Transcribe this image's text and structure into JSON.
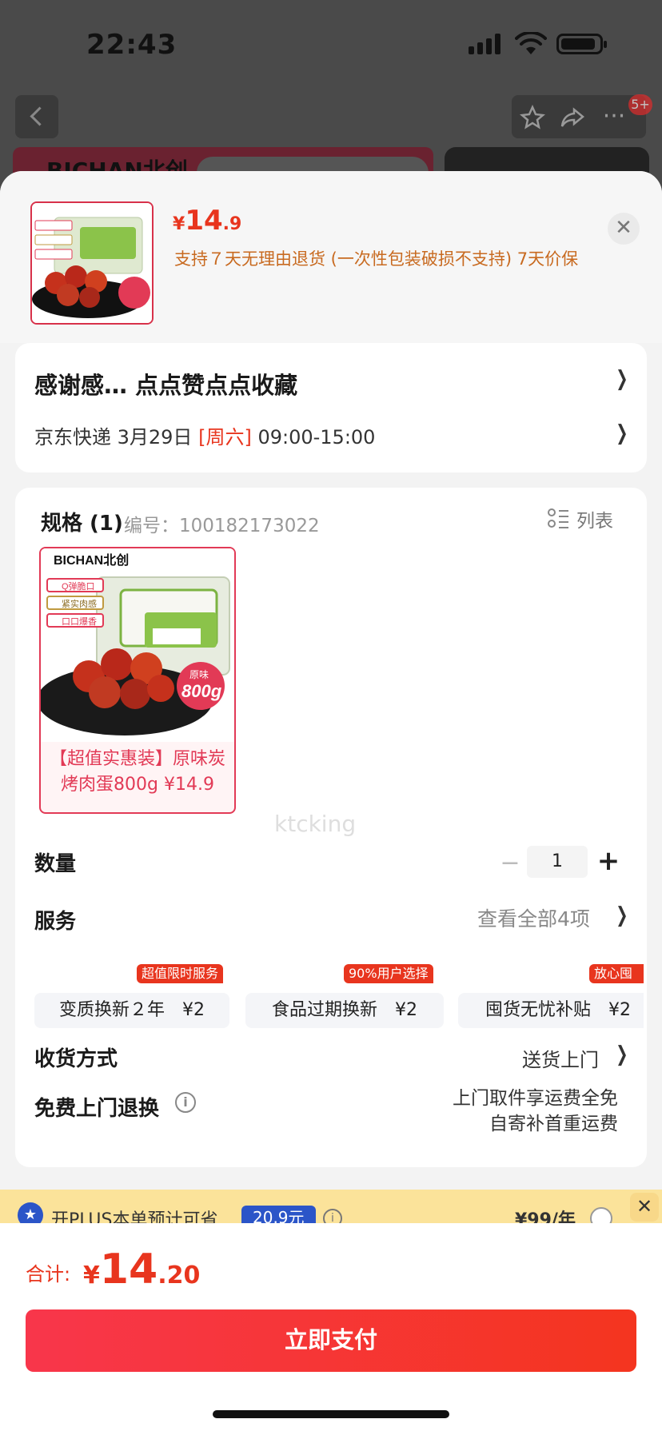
{
  "status": {
    "time": "22:43"
  },
  "background": {
    "badge": "5+",
    "brand_text": "BICHAN北创"
  },
  "header": {
    "price_currency": "¥",
    "price_int": "14",
    "price_dec": ".9",
    "note": "支持７天无理由退货 (一次性包装破损不支持)   7天价保"
  },
  "address": {
    "title": "感谢感… 点点赞点点收藏",
    "carrier": "京东快递 3月29日",
    "weekday": "[周六]",
    "time_window": "09:00-15:00"
  },
  "spec": {
    "title": "规格 (1)",
    "code": "编号：100182173022",
    "list_label": "列表",
    "item_name": "【超值实惠装】原味炭烤肉蛋800g ¥14.9",
    "img": {
      "brand": "BICHAN北创",
      "features": [
        "Q弹脆口",
        "紧实肉感",
        "口口爆香"
      ],
      "weight": "800g",
      "flavor": "原味"
    }
  },
  "watermark": "ktcking",
  "quantity": {
    "label": "数量",
    "value": "1",
    "minus": "−",
    "plus": "+"
  },
  "service": {
    "label": "服务",
    "view_all": "查看全部4项",
    "chips": [
      {
        "text": "变质换新２年　¥2",
        "tag": "超值限时服务"
      },
      {
        "text": "食品过期换新　¥2",
        "tag": "90%用户选择"
      },
      {
        "text": "囤货无忧补贴　¥2",
        "tag": "放心囤"
      }
    ]
  },
  "receive": {
    "label": "收货方式",
    "value": "送货上门"
  },
  "free_return": {
    "label": "免费上门退换",
    "line1": "上门取件享运费全免",
    "line2": "自寄补首重运费"
  },
  "plus": {
    "text": "开PLUS本单预计可省",
    "amount": "20.9元",
    "price": "¥99/年"
  },
  "footer": {
    "total_label": "合计:",
    "currency": "¥",
    "total_int": "14",
    "total_dec": ".20",
    "pay_label": "立即支付"
  },
  "colors": {
    "accent": "#e8351e",
    "plus_blue": "#2b55c8",
    "plus_bg": "#fbe39a"
  },
  "icons": [
    "back-icon",
    "star-icon",
    "share-icon",
    "more-icon",
    "close-icon",
    "list-icon",
    "info-icon",
    "chevron-right-icon",
    "plus-crown-icon"
  ]
}
